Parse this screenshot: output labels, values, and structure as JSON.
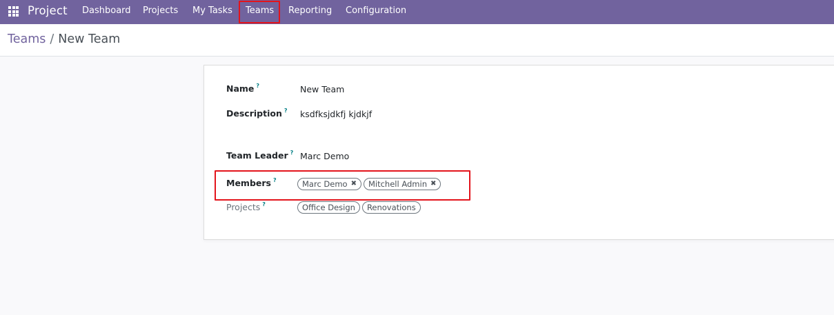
{
  "navbar": {
    "app_name": "Project",
    "menu": {
      "dashboard": "Dashboard",
      "projects": "Projects",
      "my_tasks": "My Tasks",
      "teams": "Teams",
      "reporting": "Reporting",
      "configuration": "Configuration"
    },
    "color": "#71639e"
  },
  "breadcrumb": {
    "parent": "Teams",
    "separator": "/",
    "current": "New Team"
  },
  "form": {
    "help_marker": "?",
    "name": {
      "label": "Name",
      "value": "New Team"
    },
    "description": {
      "label": "Description",
      "value": "ksdfksjdkfj kjdkjf"
    },
    "team_leader": {
      "label": "Team Leader",
      "value": "Marc Demo"
    },
    "members": {
      "label": "Members",
      "tags": [
        "Marc Demo",
        "Mitchell Admin"
      ],
      "remove_glyph": "✖"
    },
    "projects": {
      "label": "Projects",
      "tags": [
        "Office Design",
        "Renovations"
      ]
    }
  },
  "highlight_color": "#e3131b"
}
